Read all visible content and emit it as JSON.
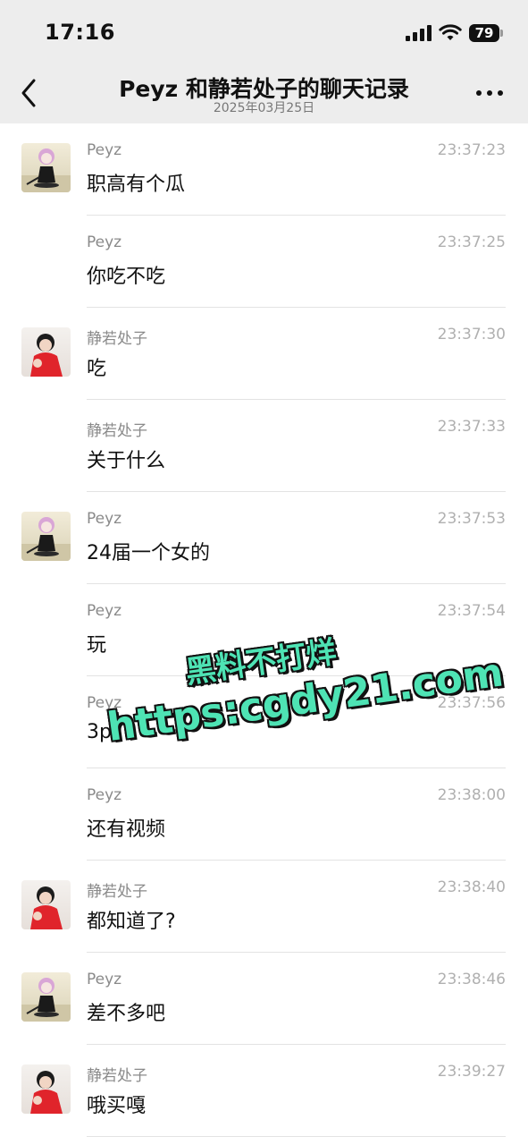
{
  "status_bar": {
    "time": "17:16",
    "battery": "79",
    "icons": [
      "signal-icon",
      "wifi-icon",
      "battery-icon"
    ]
  },
  "nav": {
    "title": "Peyz 和静若处子的聊天记录",
    "subtitle": "2025年03月25日",
    "back_icon": "chevron-left-icon",
    "more_icon": "more-icon"
  },
  "messages": [
    {
      "sender": "Peyz",
      "time": "23:37:23",
      "text": "职高有个瓜",
      "avatar": "peyz"
    },
    {
      "sender": "Peyz",
      "time": "23:37:25",
      "text": "你吃不吃",
      "avatar": ""
    },
    {
      "sender": "静若处子",
      "time": "23:37:30",
      "text": "吃",
      "avatar": "jing"
    },
    {
      "sender": "静若处子",
      "time": "23:37:33",
      "text": "关于什么",
      "avatar": ""
    },
    {
      "sender": "Peyz",
      "time": "23:37:53",
      "text": "24届一个女的",
      "avatar": "peyz"
    },
    {
      "sender": "Peyz",
      "time": "23:37:54",
      "text": "玩",
      "avatar": ""
    },
    {
      "sender": "Peyz",
      "time": "23:37:56",
      "text": "3p",
      "avatar": ""
    },
    {
      "sender": "Peyz",
      "time": "23:38:00",
      "text": "还有视频",
      "avatar": ""
    },
    {
      "sender": "静若处子",
      "time": "23:38:40",
      "text": "都知道了?",
      "avatar": "jing"
    },
    {
      "sender": "Peyz",
      "time": "23:38:46",
      "text": "差不多吧",
      "avatar": "peyz"
    },
    {
      "sender": "静若处子",
      "time": "23:39:27",
      "text": "哦买嘎",
      "avatar": "jing"
    }
  ],
  "watermark": {
    "line1": "黑料不打烊",
    "line2": "https:cgdy21.com"
  },
  "colors": {
    "header_bg": "#ededed",
    "watermark": "#4ee3b4"
  }
}
